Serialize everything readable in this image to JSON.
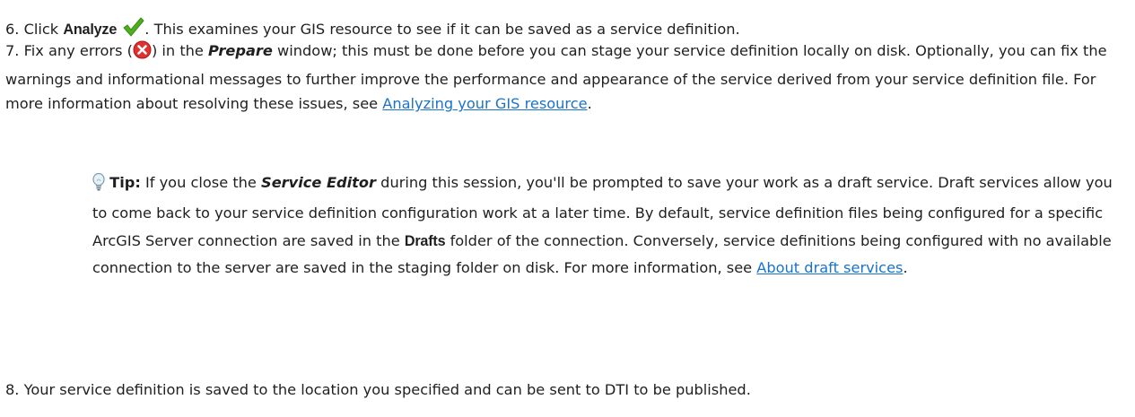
{
  "steps": {
    "s6": {
      "number": "6.",
      "click_word": "Click",
      "analyze_label": "Analyze",
      "text_after": ". This examines your GIS resource to see if it can be saved as a service definition."
    },
    "s7": {
      "number": "7.",
      "fix_text": "Fix any errors (",
      "fix_text_close": ") in the",
      "prepare_label": "Prepare",
      "text_after": "window; this must be done before you can stage your service definition locally on disk. Optionally, you can fix the warnings and informational messages to further improve the performance and appearance of the service derived from your service definition file. For more information about resolving these issues, see",
      "link_label": "Analyzing your GIS resource",
      "period": "."
    },
    "tip": {
      "label": "Tip:",
      "text_1": "If you close the",
      "service_editor_label": "Service Editor",
      "text_2": "during this session, you'll be prompted to save your work as a draft service. Draft services allow you to come back to your service definition configuration work at a later time. By default, service definition files being configured for a specific ArcGIS Server connection are saved in the",
      "drafts_label": "Drafts",
      "text_3": "folder of the connection. Conversely, service definitions being configured with no available connection to the server are saved in the staging folder on disk. For more information, see",
      "link_label": "About draft services",
      "period": "."
    },
    "s8": {
      "number": "8.",
      "text": "Your service definition is saved to the location you specified and can be sent to DTI to be published."
    }
  },
  "icons": {
    "analyze": "checkmark-icon",
    "error": "error-x-icon",
    "tip": "lightbulb-icon"
  },
  "colors": {
    "link": "#1a73c8",
    "check": "#4caf1e",
    "error": "#e03030",
    "text": "#1f1f1f"
  }
}
